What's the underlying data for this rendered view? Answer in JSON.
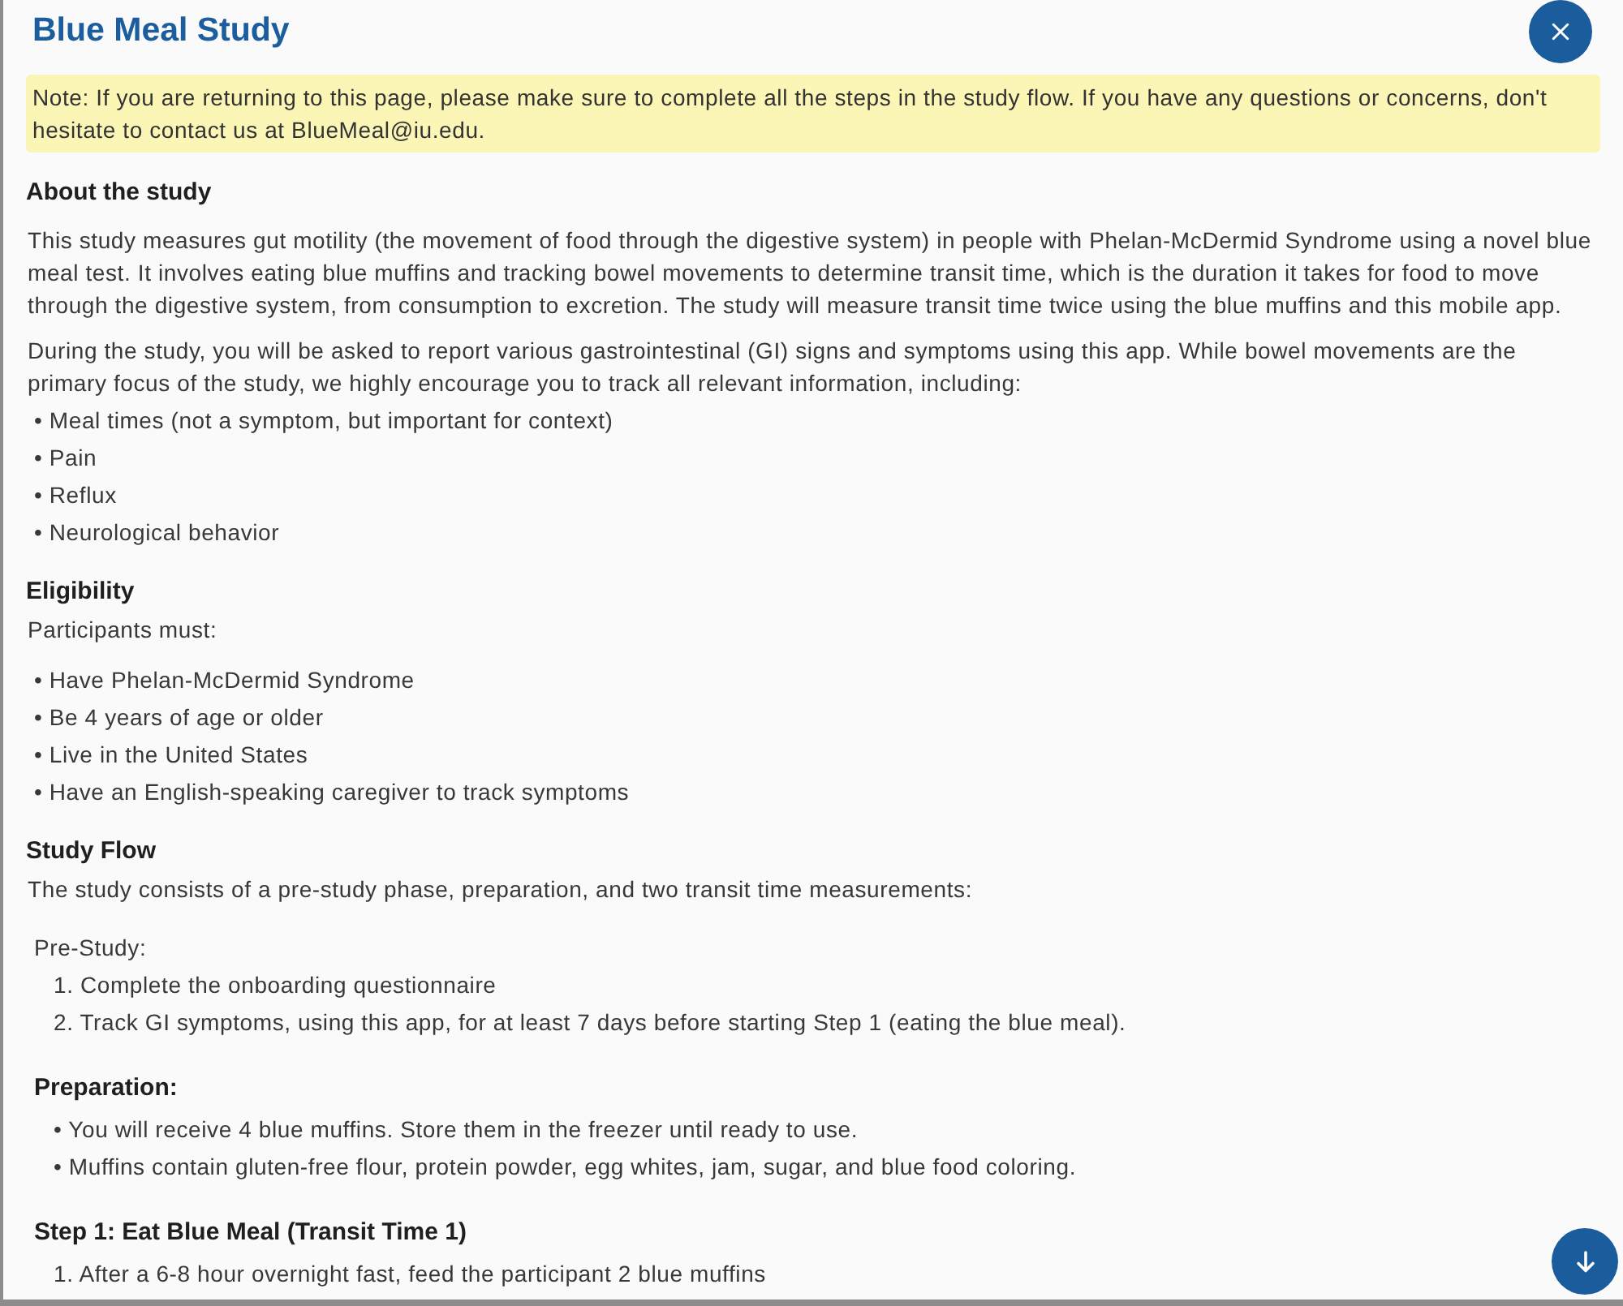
{
  "dialog": {
    "title": "Blue Meal Study"
  },
  "note": "Note: If you are returning to this page, please make sure to complete all the steps in the study flow. If you have any questions or concerns, don't hesitate to contact us at BlueMeal@iu.edu.",
  "sections": [
    {
      "heading": "About the study",
      "blocks": [
        {
          "kind": "paragraph",
          "text": "This study measures gut motility (the movement of food through the digestive system) in people with Phelan-McDermid Syndrome using a novel blue meal test. It involves eating blue muffins and tracking bowel movements to determine transit time, which is the duration it takes for food to move through the digestive system, from consumption to excretion. The study will measure transit time twice using the blue muffins and this mobile app."
        },
        {
          "kind": "paragraph",
          "text": "During the study, you will be asked to report various gastrointestinal (GI) signs and symptoms using this app. While bowel movements are the primary focus of the study, we highly encourage you to track all relevant information, including:"
        },
        {
          "kind": "list",
          "items": [
            "• Meal times (not a symptom, but important for context)",
            "• Pain",
            "• Reflux",
            "• Neurological behavior"
          ]
        }
      ]
    },
    {
      "heading": "Eligibility",
      "blocks": [
        {
          "kind": "lead",
          "text": "Participants must:"
        },
        {
          "kind": "list",
          "items": [
            "• Have Phelan-McDermid Syndrome",
            "• Be 4 years of age or older",
            "• Live in the United States",
            "• Have an English-speaking caregiver to track symptoms"
          ]
        }
      ]
    },
    {
      "heading": "Study Flow",
      "blocks": [
        {
          "kind": "lead",
          "text": "The study consists of a pre-study phase, preparation, and two transit time measurements:"
        },
        {
          "kind": "group",
          "title": "Pre-Study:",
          "items": [
            "1. Complete the onboarding questionnaire",
            "2. Track GI symptoms, using this app, for at least 7 days before starting Step 1 (eating the blue meal)."
          ]
        },
        {
          "kind": "subsection",
          "title": "Preparation:",
          "items": [
            "• You will receive 4 blue muffins. Store them in the freezer until ready to use.",
            "• Muffins contain gluten-free flour, protein powder, egg whites, jam, sugar, and blue food coloring."
          ]
        },
        {
          "kind": "subsection",
          "title": "Step 1: Eat Blue Meal (Transit Time 1)",
          "items": [
            "1. After a 6-8 hour overnight fast, feed the participant 2 blue muffins"
          ]
        }
      ]
    }
  ]
}
